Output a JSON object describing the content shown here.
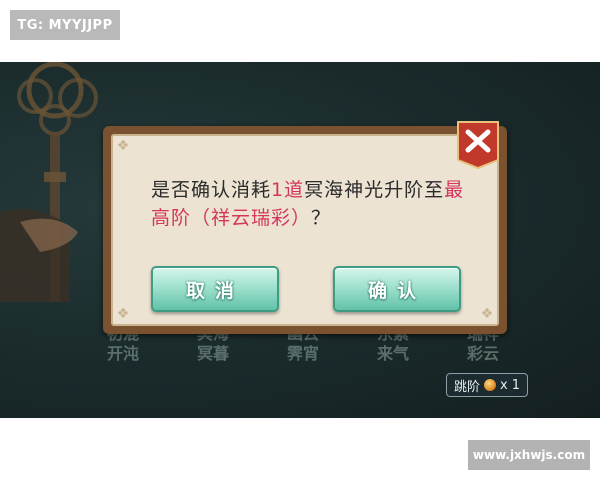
{
  "watermark_top": "TG: MYYJJPP",
  "watermark_bottom": "www.jxhwjs.com",
  "dialog": {
    "msg_part1": "是否确认消耗",
    "msg_highlight1": "1道",
    "msg_part2": "冥海神光升阶至",
    "msg_highlight2": "最高阶（祥云瑞彩）",
    "msg_part3": "？",
    "cancel_label": "取消",
    "confirm_label": "确认",
    "close_icon": "close-x-icon"
  },
  "scene_options": [
    {
      "line1": "初混",
      "line2": "开沌"
    },
    {
      "line1": "冥海",
      "line2": "冥暮"
    },
    {
      "line1": "幽云",
      "line2": "霁宵"
    },
    {
      "line1": "东紫",
      "line2": "来气"
    },
    {
      "line1": "瑞祥",
      "line2": "彩云"
    }
  ],
  "skip": {
    "label": "跳阶",
    "count": "x 1"
  },
  "colors": {
    "highlight": "#d4375e",
    "button": "#7fd3bc",
    "dialog_frame": "#7a5230",
    "close_badge": "#c0392b"
  }
}
